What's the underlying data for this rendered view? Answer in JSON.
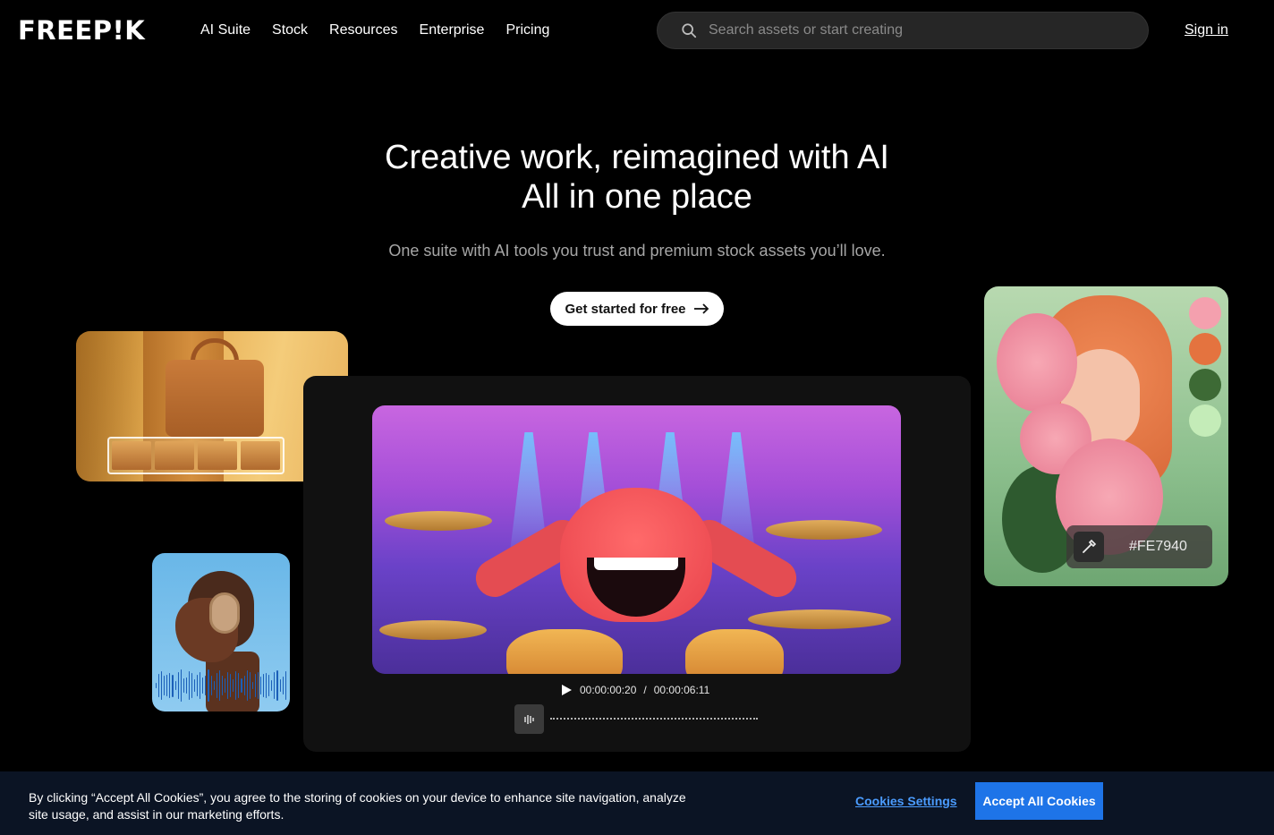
{
  "brand": {
    "logo_text": "FREEP!K"
  },
  "nav": {
    "items": [
      {
        "label": "AI Suite"
      },
      {
        "label": "Stock"
      },
      {
        "label": "Resources"
      },
      {
        "label": "Enterprise"
      },
      {
        "label": "Pricing"
      }
    ]
  },
  "search": {
    "placeholder": "Search assets or start creating",
    "value": ""
  },
  "header": {
    "signin_label": "Sign in"
  },
  "hero": {
    "title_line1": "Creative work, reimagined with AI",
    "title_line2": "All in one place",
    "subtitle": "One suite with AI tools you trust and premium stock assets you’ll love.",
    "cta_label": "Get started for free"
  },
  "player": {
    "current_time": "00:00:00:20",
    "separator": "/",
    "total_time": "00:00:06:11"
  },
  "palette": {
    "swatches": [
      "#F4A0AE",
      "#E4733F",
      "#3D6A35",
      "#C4ECB8"
    ],
    "picked_hex": "#FE7940"
  },
  "cookie_banner": {
    "message": "By clicking “Accept All Cookies”, you agree to the storing of cookies on your device to enhance site navigation, analyze site usage, and assist in our marketing efforts.",
    "settings_label": "Cookies Settings",
    "accept_label": "Accept All Cookies"
  }
}
